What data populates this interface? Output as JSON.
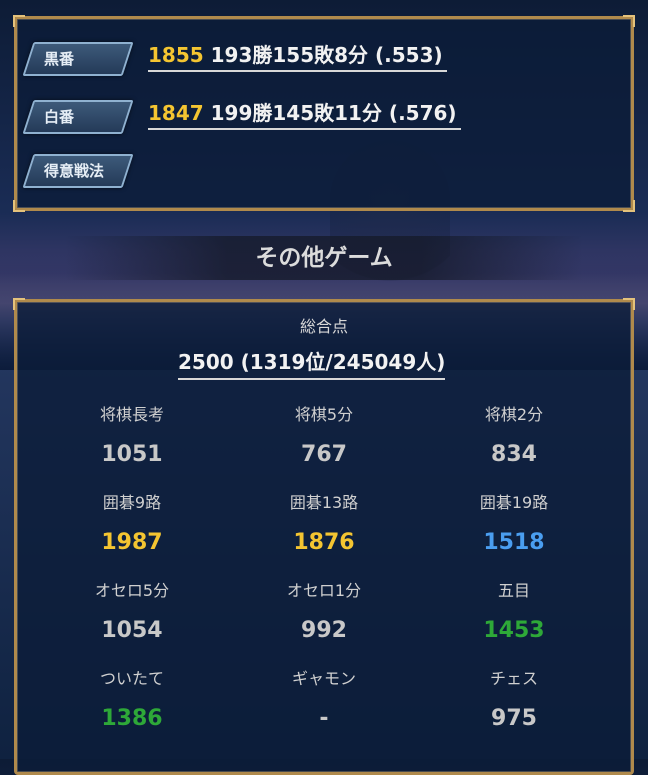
{
  "records": {
    "black": {
      "label": "黒番",
      "rate": "1855",
      "detail": "193勝155敗8分 (.553)"
    },
    "white": {
      "label": "白番",
      "rate": "1847",
      "detail": "199勝145敗11分 (.576)"
    },
    "strategy": {
      "label": "得意戦法"
    }
  },
  "other_games": {
    "title": "その他ゲーム",
    "total_label": "総合点",
    "total_value": "2500 (1319位/245049人)",
    "games": [
      {
        "name": "将棋長考",
        "score": "1051",
        "color": "#c8c8c8"
      },
      {
        "name": "将棋5分",
        "score": "767",
        "color": "#c8c8c8"
      },
      {
        "name": "将棋2分",
        "score": "834",
        "color": "#c8c8c8"
      },
      {
        "name": "囲碁9路",
        "score": "1987",
        "color": "#f4c531"
      },
      {
        "name": "囲碁13路",
        "score": "1876",
        "color": "#f4c531"
      },
      {
        "name": "囲碁19路",
        "score": "1518",
        "color": "#4a9ef0"
      },
      {
        "name": "オセロ5分",
        "score": "1054",
        "color": "#c8c8c8"
      },
      {
        "name": "オセロ1分",
        "score": "992",
        "color": "#c8c8c8"
      },
      {
        "name": "五目",
        "score": "1453",
        "color": "#2ea838"
      },
      {
        "name": "ついたて",
        "score": "1386",
        "color": "#2ea838"
      },
      {
        "name": "ギャモン",
        "score": "-",
        "color": "#c8c8c8"
      },
      {
        "name": "チェス",
        "score": "975",
        "color": "#c8c8c8"
      }
    ]
  }
}
